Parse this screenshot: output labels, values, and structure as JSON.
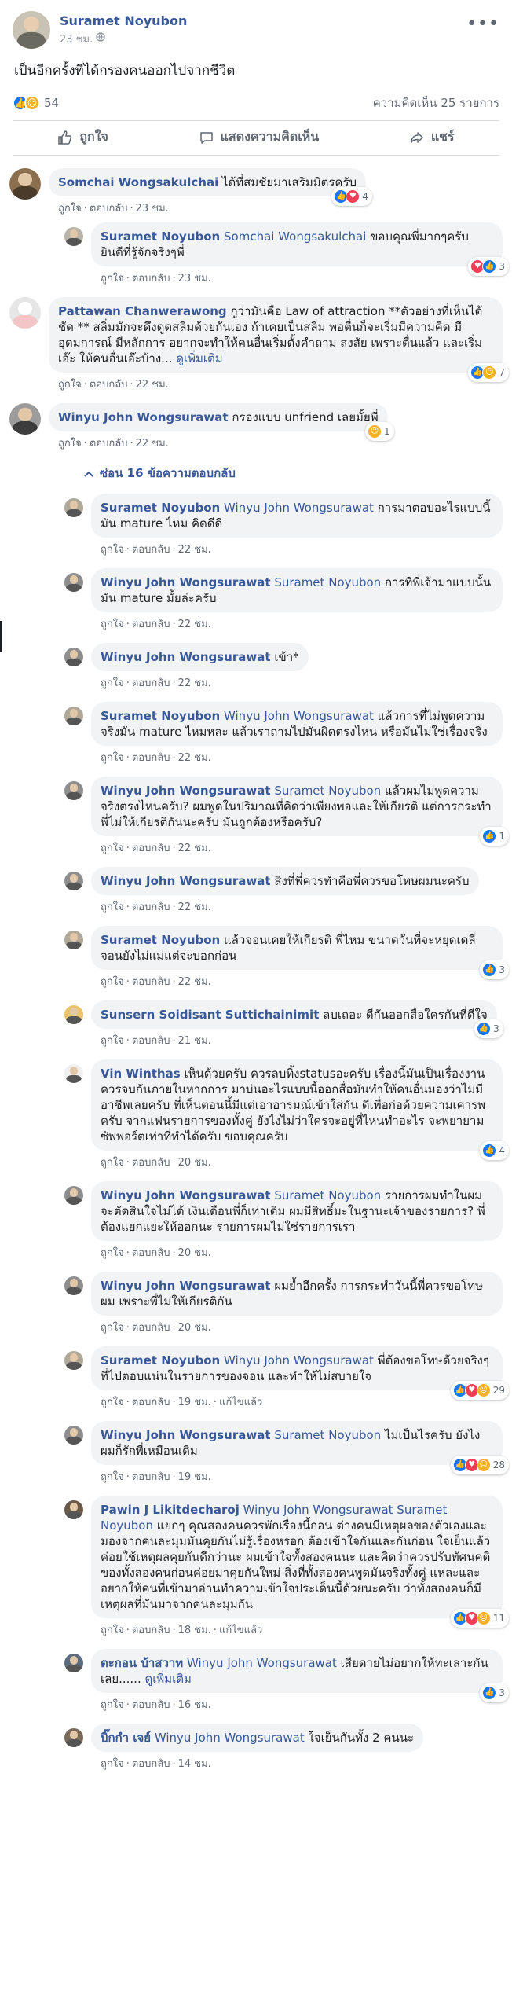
{
  "post": {
    "author": "Suramet Noyubon",
    "time": "23 ชม.",
    "text": "เป็นอีกครั้งที่ได้กรองคนออกไปจากชีวิต",
    "reaction_count": "54",
    "comment_count": "ความคิดเห็น 25 รายการ",
    "actions": {
      "like": "ถูกใจ",
      "comment": "แสดงความคิดเห็น",
      "share": "แชร์"
    }
  },
  "links": {
    "like": "ถูกใจ",
    "reply": "ตอบกลับ",
    "edited": "แก้ไขแล้ว",
    "see_more": "ดูเพิ่มเติม"
  },
  "hide_replies": "ซ่อน 16 ข้อความตอบกลับ",
  "comments": [
    {
      "name": "Somchai Wongsakulchai",
      "text": "ได้ที่สมชัยมาเสริมมิตรครับ",
      "time": "23 ชม.",
      "reactions": "4"
    },
    {
      "name": "Suramet Noyubon",
      "tag": "Somchai Wongsakulchai",
      "text": "ขอบคุณพี่มากๆครับ ยินดีที่รู้จักจริงๆพี่",
      "time": "23 ชม.",
      "reactions": "3"
    },
    {
      "name": "Pattawan Chanwerawong",
      "text": "กูว่ามันคือ Law of attraction **ตัวอย่างที่เห็นได้ชัด ** สลิ่มมักจะดึงดูดสลิ่มด้วยกันเอง ถ้าเคยเป็นสลิ่ม พอตื่นก็จะเริ่มมีความคิด มีอุดมการณ์ มีหลักการ อยากจะทำให้คนอื่นเริ่มตั้งคำถาม สงสัย เพราะตื่นแล้ว และเริ่มเอ๊ะ ให้คนอื่นเอ๊ะบ้าง...",
      "time": "22 ชม.",
      "reactions": "7"
    },
    {
      "name": "Winyu John Wongsurawat",
      "text": "กรองแบบ unfriend เลยมั้ยพี่",
      "time": "22 ชม.",
      "reactions": "1"
    }
  ],
  "replies": [
    {
      "name": "Suramet Noyubon",
      "tag": "Winyu John Wongsurawat",
      "text": "การมาตอบอะไรแบบนี้มัน mature ไหม คิดดีดี",
      "time": "22 ชม."
    },
    {
      "name": "Winyu John Wongsurawat",
      "tag": "Suramet Noyubon",
      "text": "การที่พี่เจ้ามาแบบนั้นมัน mature มั้ยล่ะครับ",
      "time": "22 ชม."
    },
    {
      "name": "Winyu John Wongsurawat",
      "text": "เข้า*",
      "time": "22 ชม."
    },
    {
      "name": "Suramet Noyubon",
      "tag": "Winyu John Wongsurawat",
      "text": "แล้วการที่ไม่พูดความจริงมัน mature ไหมหละ แล้วเราถามไปมันผิดตรงไหน หรือมันไม่ใช่เรื่องจริง",
      "time": "22 ชม."
    },
    {
      "name": "Winyu John Wongsurawat",
      "tag": "Suramet Noyubon",
      "text": "แล้วผมไม่พูดความจริงตรงไหนครับ? ผมพูดในปริมาณที่คิดว่าเพียงพอและให้เกียรติ แต่การกระทำพี่ไม่ให้เกียรติกันนะครับ มันถูกต้องหรือครับ?",
      "time": "22 ชม.",
      "reactions": "1"
    },
    {
      "name": "Winyu John Wongsurawat",
      "text": "สิ่งที่พี่ควรทำคือพี่ควรขอโทษผมนะครับ",
      "time": "22 ชม."
    },
    {
      "name": "Suramet Noyubon",
      "text": "แล้วจอนเคยให้เกียรติ พี่ไหม ขนาดวันที่จะหยุดเดลี่ จอนยังไม่แม่แต่จะบอกก่อน",
      "time": "22 ชม.",
      "reactions": "3"
    },
    {
      "name": "Sunsern Soidisant Suttichainimit",
      "text": "ลบเถอะ ดีกันออกสื่อใครกันที่ดีใจ",
      "time": "21 ชม.",
      "reactions": "3"
    },
    {
      "name": "Vin Winthas",
      "text": "เห็นด้วยครับ ควรลบทิ้งstatusอะครับ เรื่องนี้มันเป็นเรื่องงาน ควรจบกันภายในหากการ มาบ่นอะไรแบบนี้ออกสื่อมันทำให้คนอื่นมองว่าไม่มีอาชีพเลยครับ ที่เห็นตอนนี้มีแต่เอาอารมณ์เข้าใส่กัน ดีเพื่อก่อด้วยความเคารพครับ จากแฟนรายการของทั้งคู่ ยังไงไม่ว่าใครจะอยู่ที่ไหนทำอะไร จะพยายามซัพพอร์ตเท่าที่ทำได้ครับ ขอบคุณครับ",
      "time": "20 ชม.",
      "reactions": "4"
    },
    {
      "name": "Winyu John Wongsurawat",
      "tag": "Suramet Noyubon",
      "text": "รายการผมทำในผมจะตัดสินใจไม่ได้ เงินเดือนพี่ก็เท่าเดิม ผมมีสิทธิ์มะในฐานะเจ้าของรายการ? พี่ต้องแยกแยะให้ออกนะ รายการผมไม่ใช่รายการเรา",
      "time": "20 ชม."
    },
    {
      "name": "Winyu John Wongsurawat",
      "text": "ผมย้ำอีกครั้ง การกระทำวันนี้พี่ควรขอโทษผม เพราะพี่ไม่ให้เกียรติกัน",
      "time": "20 ชม."
    },
    {
      "name": "Suramet Noyubon",
      "tag": "Winyu John Wongsurawat",
      "text": "พี่ต้องขอโทษด้วยจริงๆ ที่ไปตอบแน่นในรายการของจอน และทำให้ไม่สบายใจ",
      "time": "19 ชม.",
      "edited": true,
      "reactions": "29"
    },
    {
      "name": "Winyu John Wongsurawat",
      "tag": "Suramet Noyubon",
      "text": "ไม่เป็นไรครับ ยังไงผมก็รักพี่เหมือนเดิม",
      "time": "19 ชม.",
      "reactions": "28"
    },
    {
      "name": "Pawin J Likitdecharoj",
      "tag": "Winyu John Wongsurawat Suramet Noyubon",
      "text": "แยกๆ คุณสองคนควรพักเรื่องนี้ก่อน ต่างคนมีเหตุผลของตัวเองและมองจากคนละมุมมันคุยกันไม่รู้เรื่องหรอก ต้องเข้าใจกันและกันก่อน ใจเย็นแล้วค่อยใช้เหตุผลคุยกันดีกว่านะ ผมเข้าใจทั้งสองคนนะ และคิดว่าควรปรับทัศนคติของทั้งสองคนก่อนค่อยมาคุยกันใหม่ สิ่งที่ทั้งสองคนพูดมันจริงทั้งคู่ แหละและอยากให้คนที่เข้ามาอ่านทำความเข้าใจประเด็นนี้ด้วยนะครับ ว่าทั้งสองคนก็มีเหตุผลที่มันมาจากคนละมุมกัน",
      "time": "18 ชม.",
      "edited": true,
      "reactions": "11"
    },
    {
      "name": "ตะกอน บ้าสวาท",
      "tag": "Winyu John Wongsurawat",
      "text": "เสียดายไม่อยากให้ทะเลาะกันเลย......",
      "time": "16 ชม.",
      "see_more": true,
      "reactions": "3"
    },
    {
      "name": "บิ๊กกำ เจย์",
      "tag": "Winyu John Wongsurawat",
      "text": "ใจเย็นกันทั้ง 2 คนนะ",
      "time": "14 ชม."
    }
  ]
}
